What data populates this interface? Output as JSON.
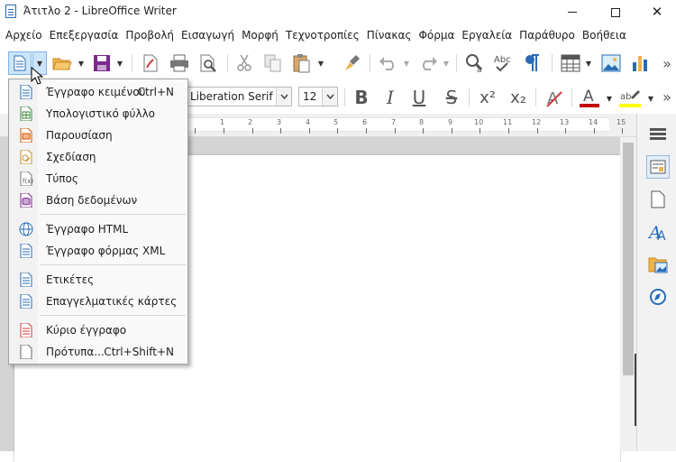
{
  "window": {
    "title": "Άτιτλο 2 - LibreOffice Writer",
    "app_icon": "writer-document-icon",
    "controls": [
      "minimize-icon",
      "maximize-icon",
      "close-icon"
    ]
  },
  "menubar": {
    "items": [
      "Αρχείο",
      "Επεξεργασία",
      "Προβολή",
      "Εισαγωγή",
      "Μορφή",
      "Τεχνοτροπίες",
      "Πίνακας",
      "Φόρμα",
      "Εργαλεία",
      "Παράθυρο",
      "Βοήθεια"
    ]
  },
  "toolbar_standard": {
    "icons": [
      "new-document-icon",
      "open-folder-icon",
      "save-icon",
      "export-pdf-icon",
      "print-icon",
      "print-preview-icon",
      "cut-icon",
      "copy-icon",
      "paste-icon",
      "clone-formatting-icon",
      "undo-icon",
      "redo-icon",
      "find-replace-icon",
      "spelling-icon",
      "formatting-marks-icon",
      "insert-table-icon",
      "insert-image-icon",
      "insert-chart-icon",
      "overflow-chevron-icon"
    ],
    "overflow_glyph": "»"
  },
  "toolbar_formatting": {
    "font_name": "Liberation Serif",
    "font_size": "12",
    "bold": "B",
    "italic": "I",
    "underline": "U",
    "strike": "S",
    "superscript": "x²",
    "subscript": "x₂",
    "overflow_glyph": "»"
  },
  "ruler": {
    "numbers": [
      "1",
      "2",
      "3",
      "4",
      "5",
      "6",
      "7",
      "8",
      "9",
      "10",
      "11",
      "12",
      "13",
      "14",
      "15"
    ]
  },
  "colors": {
    "accent_blue": "#2a6bb5",
    "font_color": "#c00000",
    "highlight": "#ffff00",
    "menu_bg": "#f9f9f9"
  },
  "new_menu": {
    "items": [
      {
        "label": "Έγγραφο κειμένου",
        "shortcut": "Ctrl+N",
        "icon": "text-document-icon"
      },
      {
        "label": "Υπολογιστικό φύλλο",
        "shortcut": "",
        "icon": "spreadsheet-icon"
      },
      {
        "label": "Παρουσίαση",
        "shortcut": "",
        "icon": "presentation-icon"
      },
      {
        "label": "Σχεδίαση",
        "shortcut": "",
        "icon": "drawing-icon"
      },
      {
        "label": "Τύπος",
        "shortcut": "",
        "icon": "formula-icon"
      },
      {
        "label": "Βάση δεδομένων",
        "shortcut": "",
        "icon": "database-icon"
      },
      {
        "label": "Έγγραφο HTML",
        "shortcut": "",
        "icon": "html-document-icon"
      },
      {
        "label": "Έγγραφο φόρμας XML",
        "shortcut": "",
        "icon": "xml-form-icon"
      },
      {
        "label": "Ετικέτες",
        "shortcut": "",
        "icon": "labels-icon"
      },
      {
        "label": "Επαγγελματικές κάρτες",
        "shortcut": "",
        "icon": "business-cards-icon"
      },
      {
        "label": "Κύριο έγγραφο",
        "shortcut": "",
        "icon": "master-document-icon"
      },
      {
        "label": "Πρότυπα...",
        "shortcut": "Ctrl+Shift+N",
        "icon": "templates-icon"
      }
    ]
  },
  "sidebar": {
    "icons": [
      "sidebar-settings-icon",
      "page-icon",
      "styles-icon",
      "gallery-icon",
      "navigator-icon"
    ]
  }
}
